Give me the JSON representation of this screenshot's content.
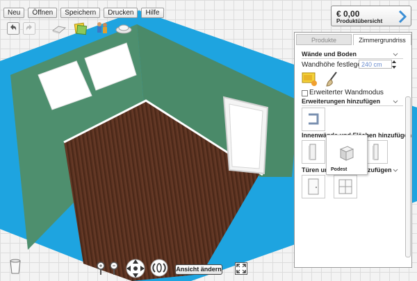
{
  "menu": {
    "items": [
      "Neu",
      "Öffnen",
      "Speichern",
      "Drucken",
      "Hilfe"
    ]
  },
  "overview": {
    "price": "€ 0,00",
    "label": "Produktübersicht"
  },
  "panel": {
    "tabs": [
      "Produkte",
      "Zimmergrundriss"
    ],
    "sections": {
      "walls_floor": "Wände und Boden",
      "wall_height_label": "Wandhöhe festlegen:",
      "wall_height_value": "240 cm",
      "advanced_wall_mode": "Erweiterter Wandmodus",
      "add_extensions": "Erweiterungen hinzufügen",
      "interior_walls": "Innenwände und Flächen hinzufügen",
      "doors_windows": "Türen und Fenster hinzufügen"
    }
  },
  "tooltip": {
    "label": "Podest"
  },
  "bottom": {
    "change_view_label": "Ansicht ändern"
  },
  "icons": [
    "undo-icon",
    "redo-icon",
    "floor-icon",
    "wallpaper-icon",
    "people-icon",
    "lamp-icon",
    "trash-icon",
    "zoom-in-icon",
    "zoom-out-icon",
    "move-icon",
    "rotate-icon",
    "fullscreen-icon",
    "paint-icon",
    "brush-icon",
    "chevron-right-icon",
    "chevron-down-icon"
  ],
  "colors": {
    "wall": "#1ea4e0",
    "wall_green": "#4e8f6e",
    "floor": "#5a3223",
    "accent_arrow": "#3a8ed5"
  }
}
